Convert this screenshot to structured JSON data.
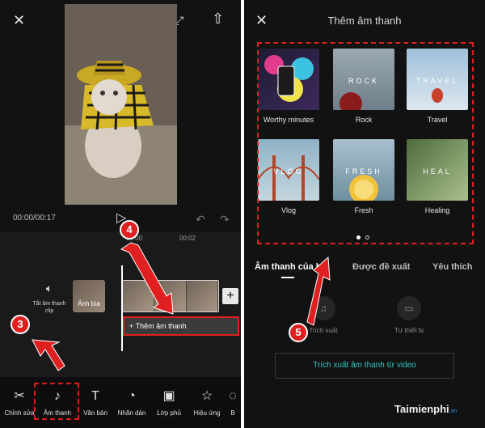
{
  "left": {
    "timecode": "00:00/00:17",
    "ruler_marks": [
      "00:00",
      "00:02"
    ],
    "mute_label": "Tắt âm thanh clip",
    "cover_label": "Ảnh bìa",
    "add_audio_label": "+ Thêm âm thanh",
    "toolbar": [
      {
        "label": "Chỉnh sửa",
        "icon": "scissors-icon"
      },
      {
        "label": "Âm thanh",
        "icon": "music-note-icon"
      },
      {
        "label": "Văn bản",
        "icon": "text-icon"
      },
      {
        "label": "Nhãn dán",
        "icon": "sticker-icon"
      },
      {
        "label": "Lớp phủ",
        "icon": "overlay-icon"
      },
      {
        "label": "Hiệu ứng",
        "icon": "effects-icon"
      },
      {
        "label": "B",
        "icon": "more-icon"
      }
    ]
  },
  "right": {
    "title": "Thêm âm thanh",
    "categories": [
      {
        "name": "Worthy minutes",
        "overlay": "",
        "color": "#2a1f3d"
      },
      {
        "name": "Rock",
        "overlay": "ROCK",
        "color": "#8a9aa6"
      },
      {
        "name": "Travel",
        "overlay": "TRAVEL",
        "color": "#a9c4d8"
      },
      {
        "name": "Vlog",
        "overlay": "VLOG",
        "color": "#7fa4b8"
      },
      {
        "name": "Fresh",
        "overlay": "FRESH",
        "color": "#9fb8c4"
      },
      {
        "name": "Healing",
        "overlay": "HEAL",
        "color": "#6f8a5e"
      }
    ],
    "tabs": [
      "Âm thanh của b",
      "Được đề xuất",
      "Yêu thích"
    ],
    "sources": [
      "Trích xuất",
      "Từ thiết bị"
    ],
    "extract_button": "Trích xuất âm thanh từ video"
  },
  "annotations": [
    "3",
    "4",
    "5"
  ],
  "watermark": {
    "brand": "Taimienphi",
    "suffix": ".vn"
  },
  "colors": {
    "accent_red": "#e02020",
    "accent_teal": "#2fc7c0",
    "background": "#121212"
  }
}
